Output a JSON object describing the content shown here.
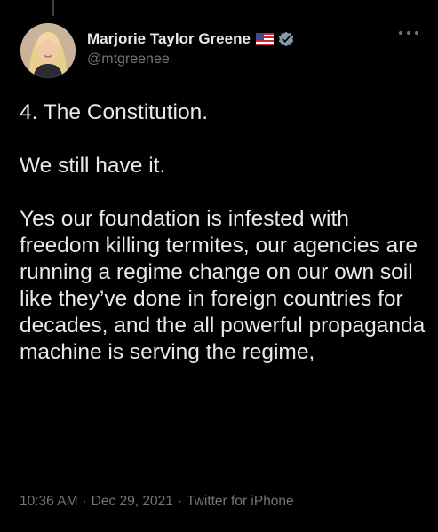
{
  "tweet": {
    "author": {
      "display_name": "Marjorie Taylor Greene",
      "handle": "@mtgreenee",
      "badges": [
        "us-flag-icon",
        "verified-badge-icon"
      ]
    },
    "more_icon": "more-options-icon",
    "paragraphs": [
      "4. The Constitution.",
      "We still have it.",
      "Yes our foundation is infested with freedom killing termites, our agencies are running a regime change on our own soil like they’ve done in foreign countries for decades, and the all powerful propaganda machine is serving the regime,"
    ],
    "meta": {
      "time": "10:36 AM",
      "separator": "·",
      "date": "Dec 29, 2021",
      "source": "Twitter for iPhone"
    }
  },
  "colors": {
    "background": "#000000",
    "text_primary": "#e7e9ea",
    "text_secondary": "#71767b",
    "verified": "#829aab"
  }
}
